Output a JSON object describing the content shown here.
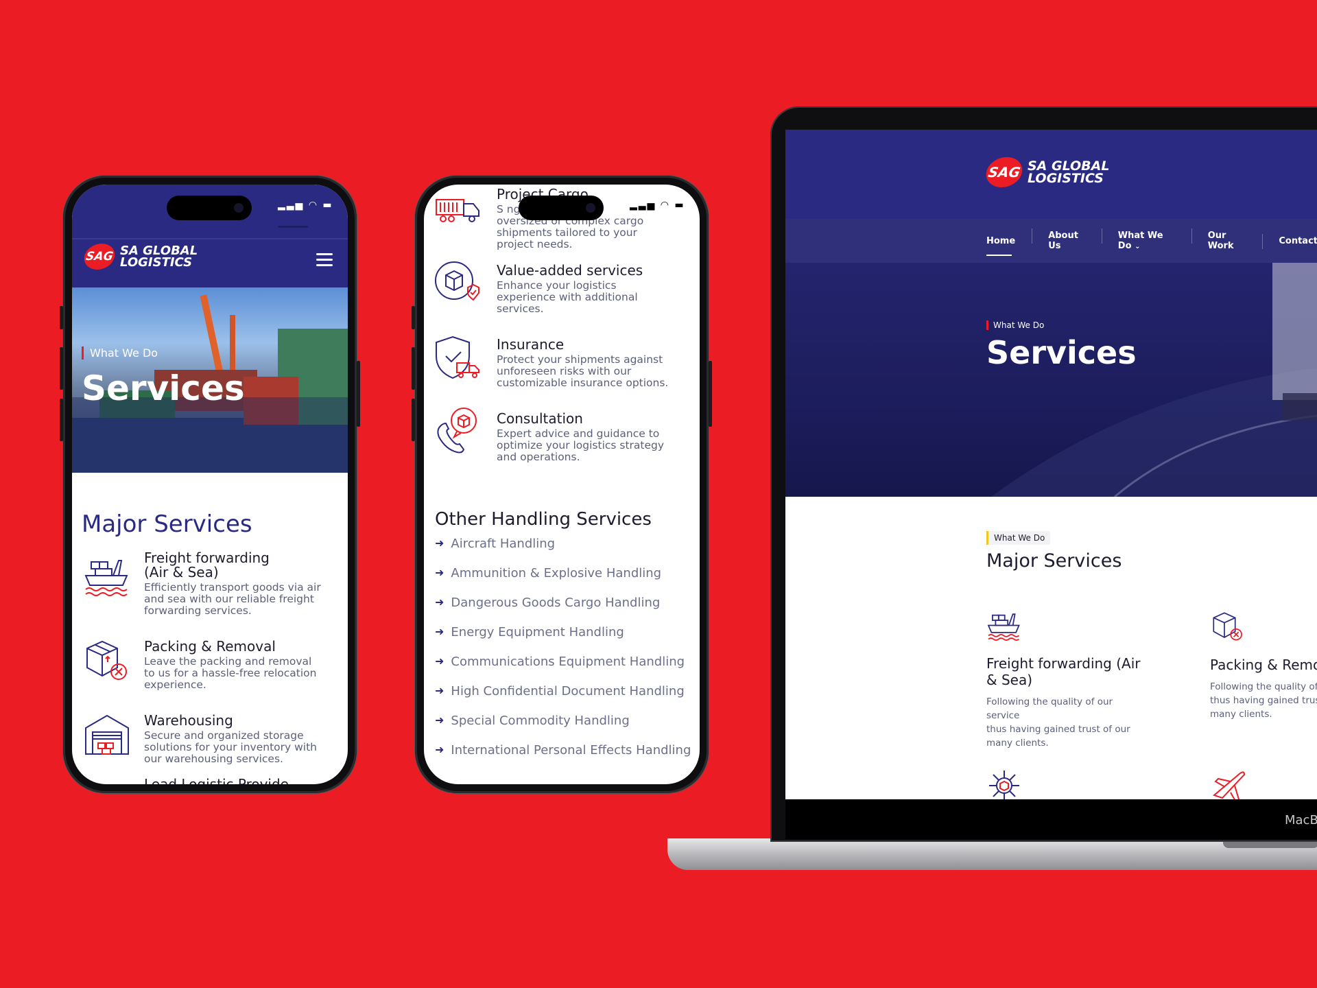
{
  "brand": {
    "badge": "SAG",
    "line1": "SA GLOBAL",
    "line2": "LOGISTICS"
  },
  "colors": {
    "background": "#ec1c24",
    "navy": "#2a2a82",
    "accent_red": "#ec1c24",
    "tag_yellow": "#f5c518"
  },
  "phone1": {
    "hero_eyebrow": "What We Do",
    "hero_title": "Services",
    "section_title": "Major Services",
    "services": [
      {
        "icon": "ship-icon",
        "title_l1": "Freight forwarding",
        "title_l2": "(Air & Sea)",
        "desc": [
          "Efficiently transport goods via air",
          "and sea with our reliable freight",
          "forwarding services."
        ]
      },
      {
        "icon": "box-icon",
        "title_l1": "Packing & Removal",
        "title_l2": "",
        "desc": [
          "Leave the packing and removal",
          "to us for a hassle-free relocation",
          "experience."
        ]
      },
      {
        "icon": "warehouse-icon",
        "title_l1": "Warehousing",
        "title_l2": "",
        "desc": [
          "Secure and organized storage",
          "solutions for your inventory with",
          "our warehousing services."
        ]
      }
    ],
    "cut_title": "Lead Logistic Provide"
  },
  "phone2": {
    "top_title": "Project Cargo",
    "top_desc": [
      "S              ng for",
      "oversized or complex cargo",
      "shipments tailored to your",
      "project needs."
    ],
    "services": [
      {
        "icon": "package-shield-icon",
        "title": "Value-added services",
        "desc": [
          "Enhance your logistics",
          "experience with additional",
          "services."
        ]
      },
      {
        "icon": "shield-truck-icon",
        "title": "Insurance",
        "desc": [
          "Protect your shipments against",
          "unforeseen risks with our",
          "customizable insurance options."
        ]
      },
      {
        "icon": "phone-chat-icon",
        "title": "Consultation",
        "desc": [
          "Expert advice and guidance to",
          "optimize your logistics strategy",
          "and operations."
        ]
      }
    ],
    "other_title": "Other Handling Services",
    "other_items": [
      "Aircraft Handling",
      "Ammunition & Explosive Handling",
      "Dangerous Goods Cargo Handling",
      "Energy Equipment Handling",
      "Communications Equipment Handling",
      "High Confidential Document Handling",
      "Special Commodity Handling",
      "International Personal Effects Handling"
    ]
  },
  "laptop": {
    "nav": [
      "Home",
      "About Us",
      "What We Do",
      "Our Work",
      "Contact"
    ],
    "hero_eyebrow": "What We Do",
    "hero_title": "Services",
    "section_tag": "What We Do",
    "section_title": "Major Services",
    "cards": [
      {
        "icon": "ship-icon",
        "title_l1": "Freight forwarding (Air",
        "title_l2": "& Sea)",
        "desc": [
          "Following the quality of our service",
          "thus having gained trust of our",
          "many clients."
        ]
      },
      {
        "icon": "box-icon",
        "title_l1": "Packing & Remov",
        "title_l2": "",
        "desc": [
          "Following the quality of o",
          "thus having gained trust",
          "many clients."
        ]
      }
    ],
    "brand_label": "MacB"
  }
}
